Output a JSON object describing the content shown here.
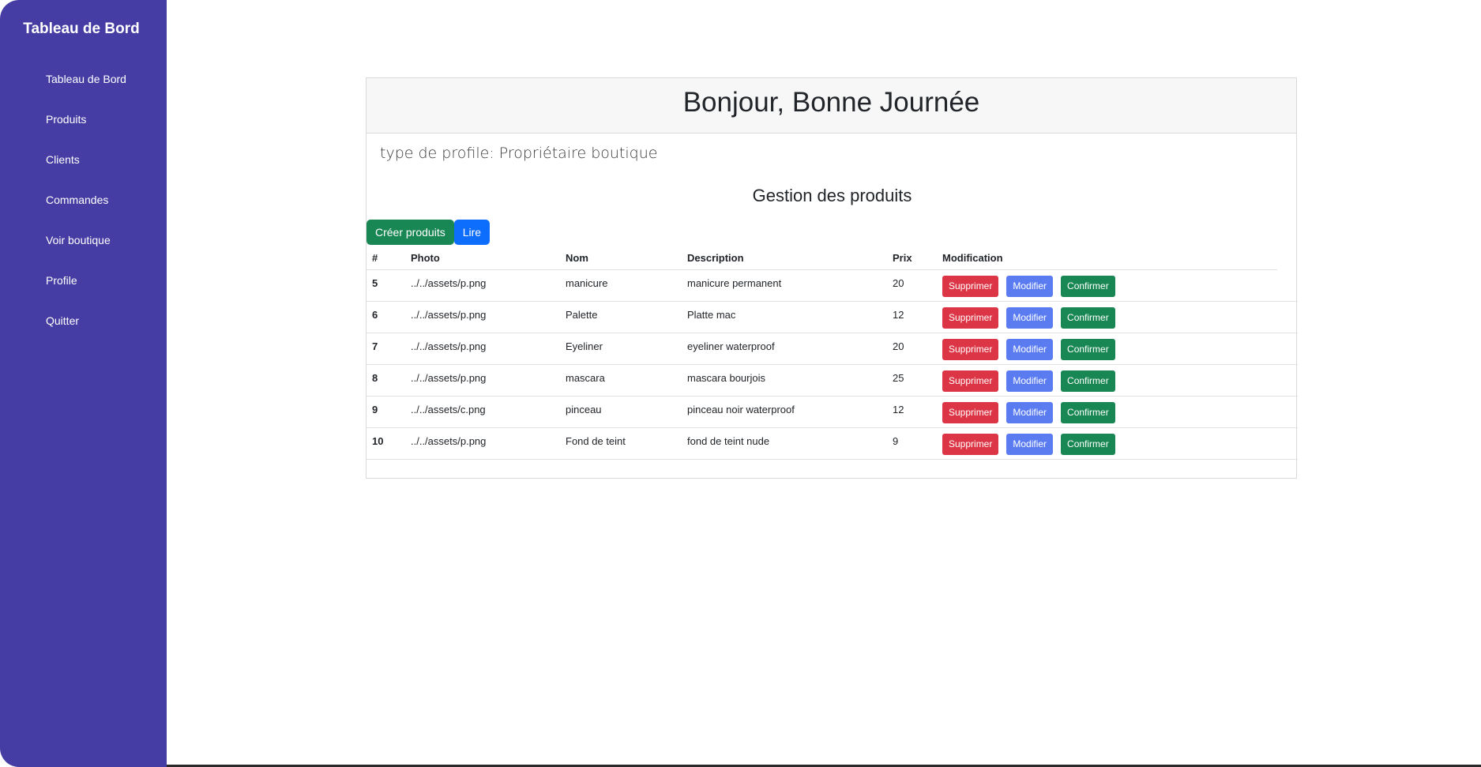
{
  "sidebar": {
    "brand": "Tableau de Bord",
    "items": [
      {
        "label": "Tableau de Bord",
        "name": "sidebar-item-tableau-de-bord"
      },
      {
        "label": "Produits",
        "name": "sidebar-item-produits"
      },
      {
        "label": "Clients",
        "name": "sidebar-item-clients"
      },
      {
        "label": "Commandes",
        "name": "sidebar-item-commandes"
      },
      {
        "label": "Voir boutique",
        "name": "sidebar-item-voir-boutique"
      },
      {
        "label": "Profile",
        "name": "sidebar-item-profile"
      },
      {
        "label": "Quitter",
        "name": "sidebar-item-quitter"
      }
    ]
  },
  "card": {
    "greeting": "Bonjour, Bonne Journée",
    "profile_line": "type de profile: Propriétaire boutique",
    "section_title": "Gestion des produits",
    "create_button": "Créer produits",
    "read_button": "Lire"
  },
  "table": {
    "headers": [
      "#",
      "Photo",
      "Nom",
      "Description",
      "Prix",
      "Modification"
    ],
    "rows": [
      {
        "id": "5",
        "photo": "../../assets/p.png",
        "nom": "manicure",
        "description": "manicure permanent",
        "prix": "20"
      },
      {
        "id": "6",
        "photo": "../../assets/p.png",
        "nom": "Palette",
        "description": "Platte mac",
        "prix": "12"
      },
      {
        "id": "7",
        "photo": "../../assets/p.png",
        "nom": "Eyeliner",
        "description": "eyeliner waterproof",
        "prix": "20"
      },
      {
        "id": "8",
        "photo": "../../assets/p.png",
        "nom": "mascara",
        "description": "mascara bourjois",
        "prix": "25"
      },
      {
        "id": "9",
        "photo": "../../assets/c.png",
        "nom": "pinceau",
        "description": "pinceau noir waterproof",
        "prix": "12"
      },
      {
        "id": "10",
        "photo": "../../assets/p.png",
        "nom": "Fond de teint",
        "description": "fond de teint nude",
        "prix": "9"
      }
    ],
    "actions": {
      "delete": "Supprimer",
      "edit": "Modifier",
      "confirm": "Confirmer"
    }
  },
  "colors": {
    "sidebar_bg": "#453da3",
    "create_green": "#198754",
    "read_blue": "#0d6efd",
    "delete_red": "#dc3545",
    "edit_blue": "#5a7cf0",
    "confirm_green": "#198754"
  }
}
